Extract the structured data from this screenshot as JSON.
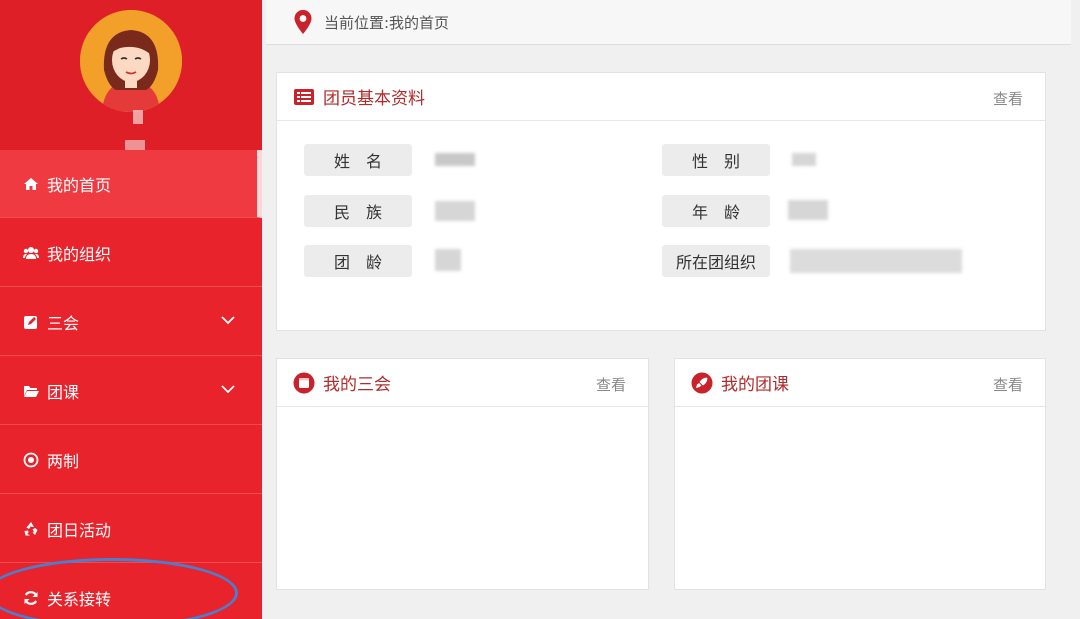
{
  "breadcrumb": {
    "text": "当前位置:我的首页"
  },
  "sidebar": {
    "items": [
      {
        "label": "我的首页",
        "icon": "home-icon",
        "active": true
      },
      {
        "label": "我的组织",
        "icon": "users-icon"
      },
      {
        "label": "三会",
        "icon": "edit-icon",
        "has_chevron": true
      },
      {
        "label": "团课",
        "icon": "folder-open-icon",
        "has_chevron": true
      },
      {
        "label": "两制",
        "icon": "dot-circle-icon"
      },
      {
        "label": "团日活动",
        "icon": "recycle-icon"
      },
      {
        "label": "关系接转",
        "icon": "refresh-icon"
      }
    ]
  },
  "profile_panel": {
    "title": "团员基本资料",
    "more": "查看",
    "fields": [
      {
        "label": "姓　名"
      },
      {
        "label": "性　别"
      },
      {
        "label": "民　族"
      },
      {
        "label": "年　龄"
      },
      {
        "label": "团　龄"
      },
      {
        "label": "所在团组织"
      }
    ]
  },
  "meetings_panel": {
    "title": "我的三会",
    "more": "查看"
  },
  "lessons_panel": {
    "title": "我的团课",
    "more": "查看"
  },
  "colors": {
    "sidebar": "#e8232b",
    "accent": "#b22a2a",
    "highlight_ring": "#4a7fd0"
  }
}
